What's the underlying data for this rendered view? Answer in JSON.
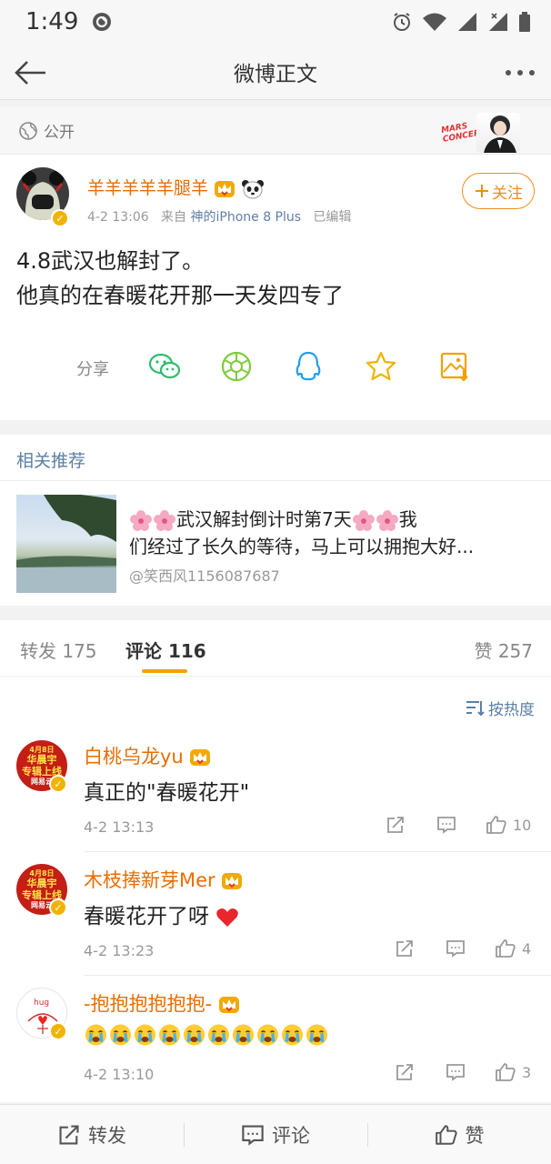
{
  "status_bar": {
    "time": "1:49"
  },
  "nav": {
    "title": "微博正文"
  },
  "visibility": {
    "label": "公开",
    "badge_text": "MARS CONCERT"
  },
  "post": {
    "username": "羊羊羊羊羊腿羊",
    "time": "4-2 13:06",
    "source_prefix": "来自",
    "source": "神的iPhone 8 Plus",
    "edited": "已编辑",
    "follow_label": "关注",
    "text_lines": [
      "4.8武汉也解封了。",
      "他真的在春暖花开那一天发四专了"
    ],
    "share_label": "分享"
  },
  "related": {
    "header": "相关推荐",
    "title_main": "武汉解封倒计时第7天",
    "title_tail": "我",
    "line2": "们经过了长久的等待，马上可以拥抱大好...",
    "source": "@笑西风1156087687"
  },
  "tabs": {
    "repost": "转发 175",
    "comment": "评论 116",
    "like": "赞 257",
    "sort_label": "按热度"
  },
  "comments": [
    {
      "name": "白桃乌龙yu",
      "text": "真正的\"春暖花开\"",
      "time": "4-2 13:13",
      "likes": "10",
      "avatar_lines": [
        "4月8日",
        "华晨宇",
        "专辑上线",
        "网易云"
      ]
    },
    {
      "name": "木枝捧新芽Mer",
      "text": "春暖花开了呀",
      "time": "4-2 13:23",
      "likes": "4",
      "avatar_lines": [
        "4月8日",
        "华晨宇",
        "专辑上线",
        "网易云"
      ]
    },
    {
      "name": "-抱抱抱抱抱抱-",
      "text": "",
      "time": "4-2 13:10",
      "likes": "3",
      "avatar_text": "hug"
    }
  ],
  "bottom_bar": {
    "repost": "转发",
    "comment": "评论",
    "like": "赞"
  },
  "colors": {
    "username": "#e86d00",
    "link": "#5b7fa3",
    "follow": "#f08c1e",
    "tab_accent": "#f2a300"
  },
  "icons": [
    "back-arrow-icon",
    "more-icon",
    "globe-icon",
    "wechat-icon",
    "moments-icon",
    "qq-icon",
    "favorite-icon",
    "save-image-icon",
    "sort-icon",
    "repost-icon",
    "comment-icon",
    "like-icon",
    "heart-emoji-icon",
    "crying-emoji-icon",
    "panda-icon",
    "crown-icon",
    "blossom-icon"
  ]
}
